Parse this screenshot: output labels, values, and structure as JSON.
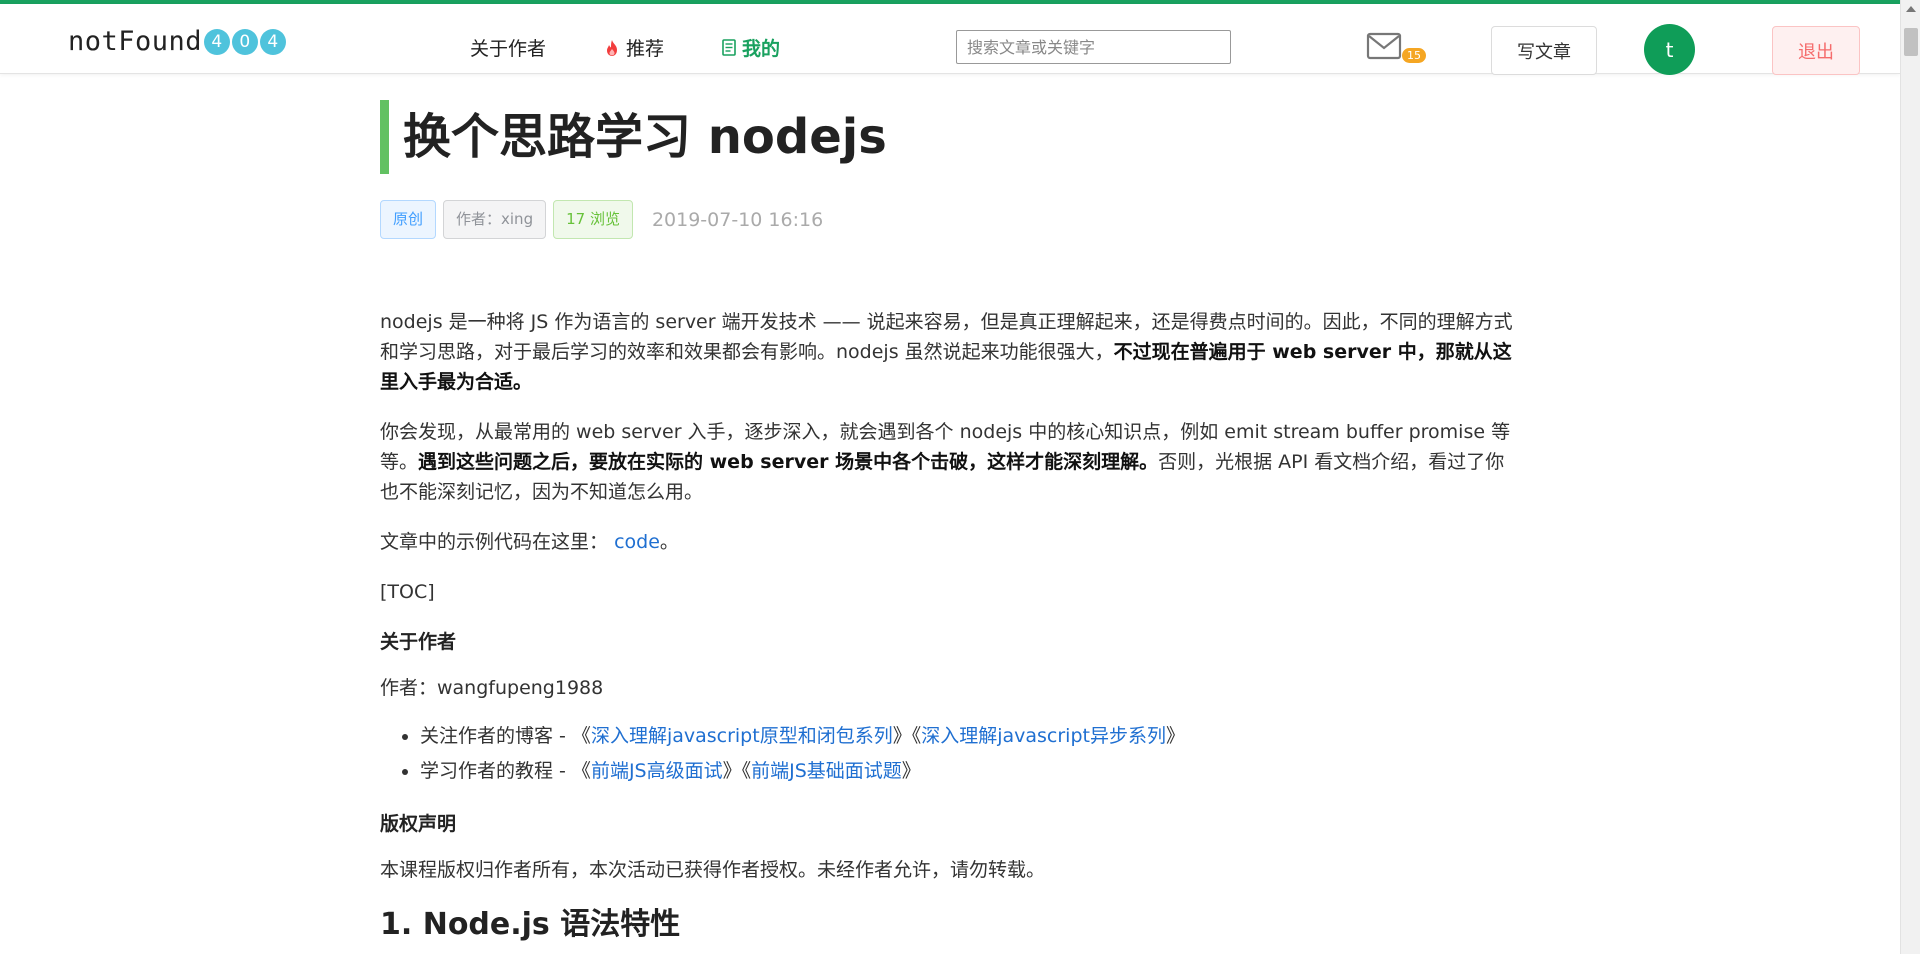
{
  "header": {
    "logo_text": "notFound",
    "logo_digits": [
      "4",
      "0",
      "4"
    ],
    "nav": {
      "about": "关于作者",
      "recommend": "推荐",
      "mine": "我的"
    },
    "search_placeholder": "搜索文章或关键字",
    "mail_badge": "15",
    "write_label": "写文章",
    "avatar_letter": "t",
    "logout_label": "退出",
    "colors": {
      "accent": "#19a15f",
      "avatar": "#0f9d58",
      "badge": "#f5a623"
    }
  },
  "article": {
    "title": "换个思路学习 nodejs",
    "tags": {
      "origin": "原创",
      "author": "作者：xing",
      "views": "17 浏览"
    },
    "date": "2019-07-10 16:16",
    "p1": {
      "a": "nodejs 是一种将 JS 作为语言的 server 端开发技术 —— 说起来容易，但是真正理解起来，还是得费点时间的。因此，不同的理解方式和学习思路，对于最后学习的效率和效果都会有影响。nodejs 虽然说起来功能很强大，",
      "b": "不过现在普遍用于 web server 中，那就从这里入手最为合适。"
    },
    "p2": {
      "a": "你会发现，从最常用的 web server 入手，逐步深入，就会遇到各个 nodejs 中的核心知识点，例如 emit stream buffer promise 等等。",
      "b": "遇到这些问题之后，要放在实际的 web server 场景中各个击破，这样才能深刻理解。",
      "c": "否则，光根据 API 看文档介绍，看过了你也不能深刻记忆，因为不知道怎么用。"
    },
    "p3": {
      "a": "文章中的示例代码在这里：",
      "link": "code",
      "c": "。"
    },
    "toc": "[TOC]",
    "about_heading": "关于作者",
    "author_line": "作者：wangfupeng1988",
    "list": [
      {
        "prefix": "关注作者的博客 - 《",
        "link1": "深入理解javascript原型和闭包系列",
        "mid": "》《",
        "link2": "深入理解javascript异步系列",
        "suffix": "》"
      },
      {
        "prefix": "学习作者的教程 - 《",
        "link1": "前端JS高级面试",
        "mid": "》《",
        "link2": "前端JS基础面试题",
        "suffix": "》"
      }
    ],
    "copyright_heading": "版权声明",
    "copyright_text": "本课程版权归作者所有，本次活动已获得作者授权。未经作者允许，请勿转载。",
    "section1_heading": "1. Node.js 语法特性"
  }
}
